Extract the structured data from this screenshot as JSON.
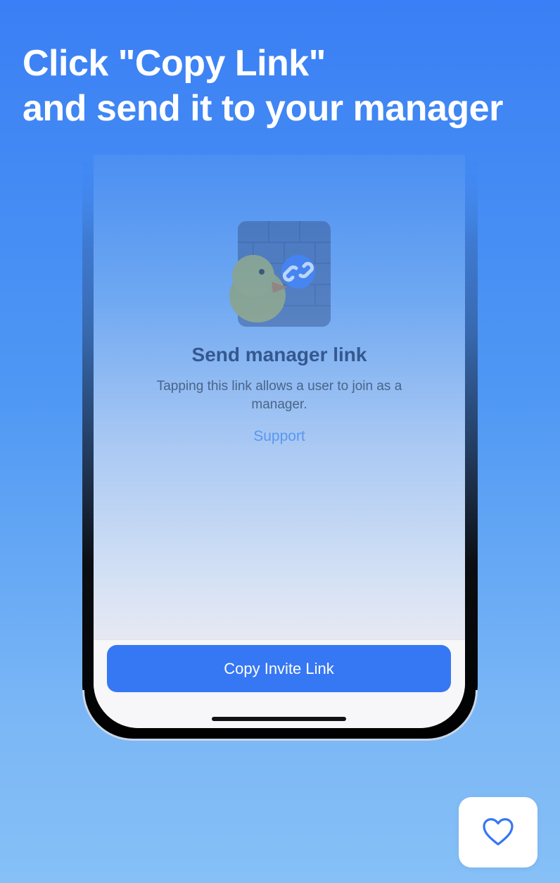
{
  "headline": {
    "line1": "Click \"Copy Link\"",
    "line2": "and send it to your manager"
  },
  "screen": {
    "title": "Send manager link",
    "description": "Tapping this link allows a user to join as a manager.",
    "support_link": "Support",
    "copy_button": "Copy Invite Link",
    "illustration": "duck-with-link-icon"
  },
  "favorite": {
    "icon": "heart-icon"
  },
  "colors": {
    "accent": "#3677f3",
    "background_top": "#3a7ff5",
    "background_bottom": "#86c0f7",
    "link": "#5a97ee"
  }
}
